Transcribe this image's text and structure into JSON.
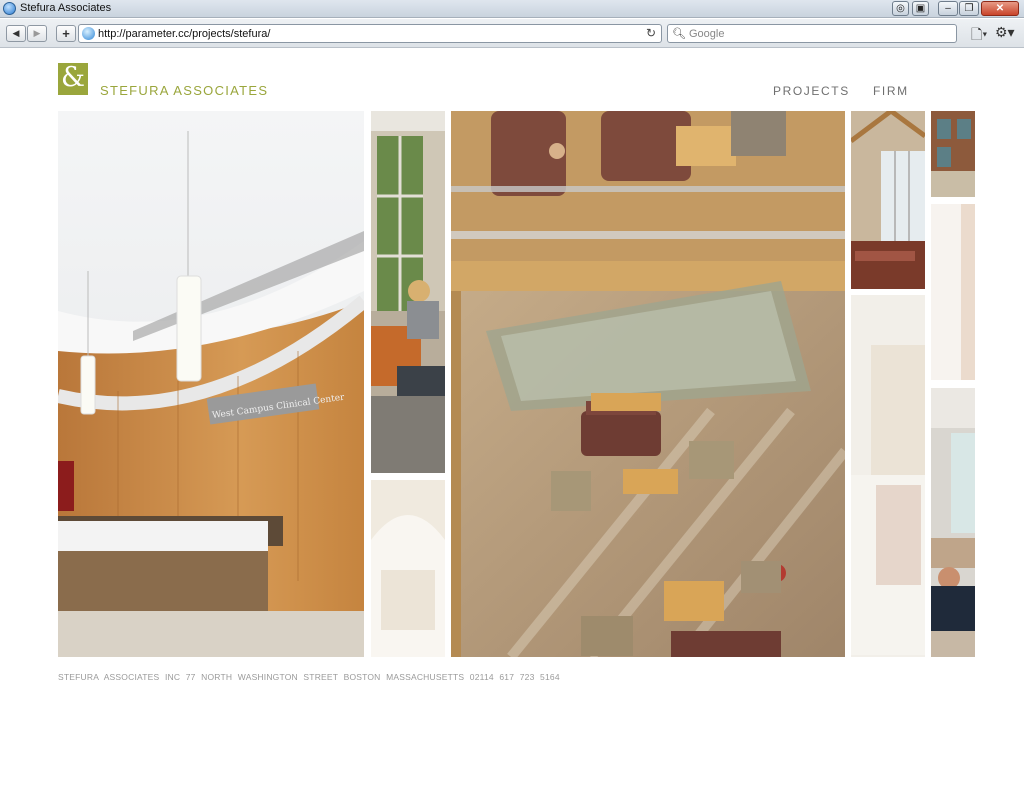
{
  "window": {
    "title": "Stefura Associates"
  },
  "browser": {
    "url": "http://parameter.cc/projects/stefura/",
    "search_placeholder": "Google",
    "back_icon": "back-arrow-icon",
    "forward_icon": "forward-arrow-icon",
    "add_icon": "plus-icon",
    "reload_icon": "reload-icon",
    "page_icon": "page-menu-icon",
    "settings_icon": "gear-icon"
  },
  "site": {
    "logo_text": "STEFURA ASSOCIATES",
    "brand_color": "#9aa63c",
    "nav": [
      {
        "label": "PROJECTS"
      },
      {
        "label": "FIRM"
      }
    ],
    "photo_sign": "West Campus Clinical Center",
    "footer": "STEFURA ASSOCIATES INC   77 NORTH WASHINGTON STREET   BOSTON MASSACHUSETTS 02114   617 723 5164"
  }
}
